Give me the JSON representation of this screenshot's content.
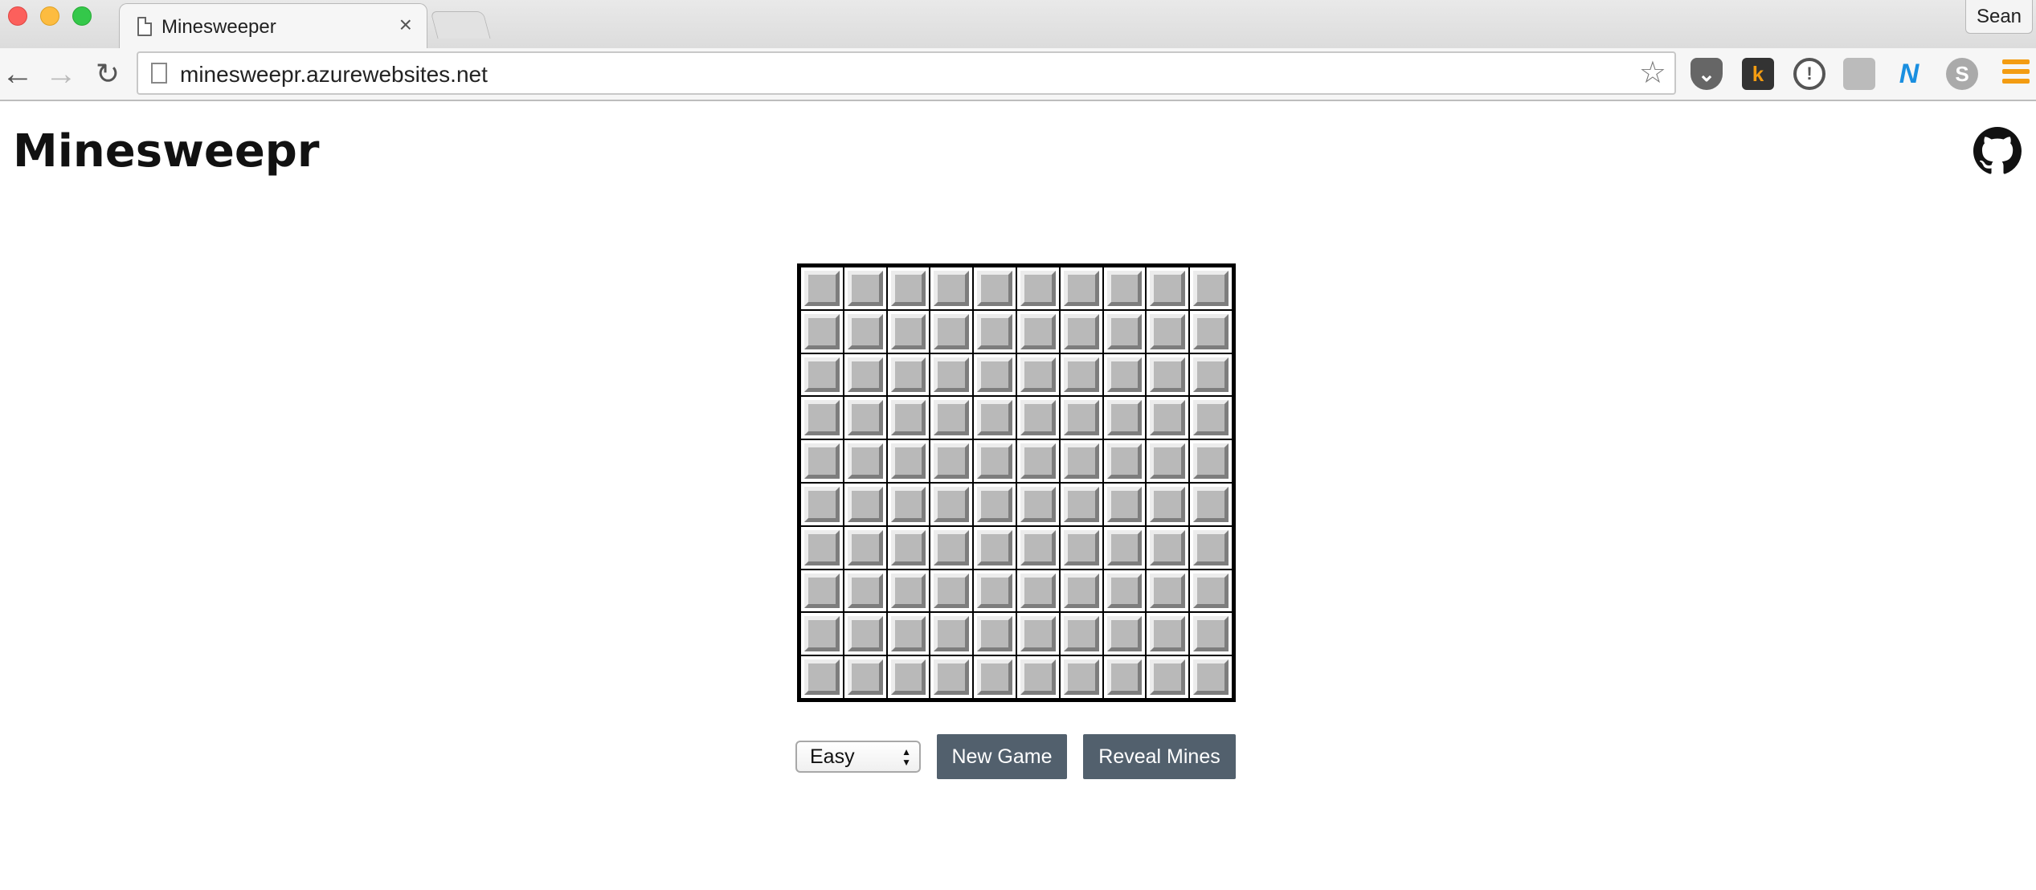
{
  "browser": {
    "tab_title": "Minesweeper",
    "tab_close": "×",
    "url": "minesweepr.azurewebsites.net",
    "profile_name": "Sean",
    "nav": {
      "back": "←",
      "forward": "→",
      "reload": "↻"
    },
    "bookmark_icon": "☆",
    "extensions": [
      {
        "name": "pocket-icon",
        "glyph": "⌄"
      },
      {
        "name": "k-extension-icon",
        "glyph": "k"
      },
      {
        "name": "onepassword-icon",
        "glyph": "!"
      },
      {
        "name": "copy-extension-icon",
        "glyph": ""
      },
      {
        "name": "n-extension-icon",
        "glyph": "N"
      },
      {
        "name": "skype-icon",
        "glyph": "S"
      }
    ]
  },
  "page": {
    "title": "Minesweepr"
  },
  "game": {
    "rows": 10,
    "cols": 10,
    "cell_state": "unrevealed",
    "difficulty": {
      "selected": "Easy",
      "arrows": "▲\n▼"
    },
    "new_game_label": "New Game",
    "reveal_mines_label": "Reveal Mines"
  },
  "colors": {
    "button_bg": "#52606d",
    "cell_face": "#b9b9b9",
    "menu_accent": "#f39c12"
  }
}
